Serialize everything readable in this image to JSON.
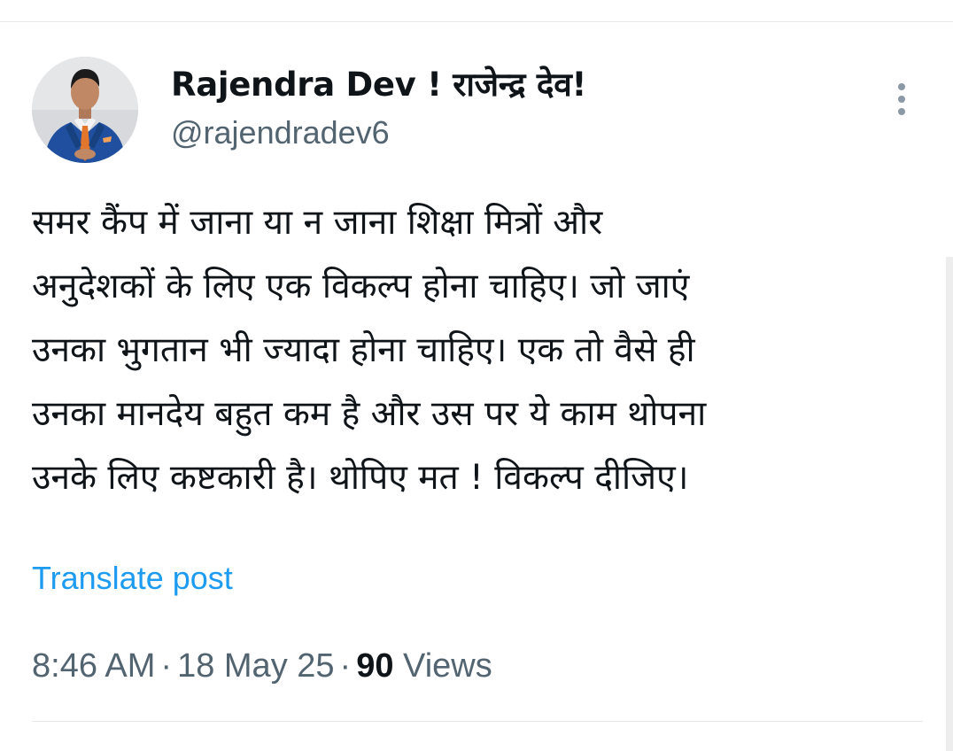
{
  "post": {
    "author": {
      "name": "Rajendra Dev ! राजेन्द्र देव!",
      "handle": "@rajendradev6",
      "avatar_icon": "profile-photo-man-blue-suit"
    },
    "more_icon": "more-vertical-icon",
    "text_lines": [
      "समर कैंप में जाना या न जाना शिक्षा मित्रों और",
      "अनुदेशकों के लिए एक विकल्प होना चाहिए। जो जाएं",
      "उनका भुगतान भी ज्यादा होना चाहिए। एक तो वैसे ही",
      "उनका मानदेय बहुत कम है और उस पर ये काम थोपना",
      "उनके लिए कष्टकारी है। थोपिए मत ! विकल्प दीजिए।"
    ],
    "translate_label": "Translate post",
    "time": "8:46 AM",
    "separator": "·",
    "date": "18 May 25",
    "views_count": "90",
    "views_label": "Views"
  },
  "colors": {
    "text_primary": "#0f1419",
    "text_secondary": "#536471",
    "link": "#1d9bf0",
    "divider": "#e6e9ec"
  }
}
